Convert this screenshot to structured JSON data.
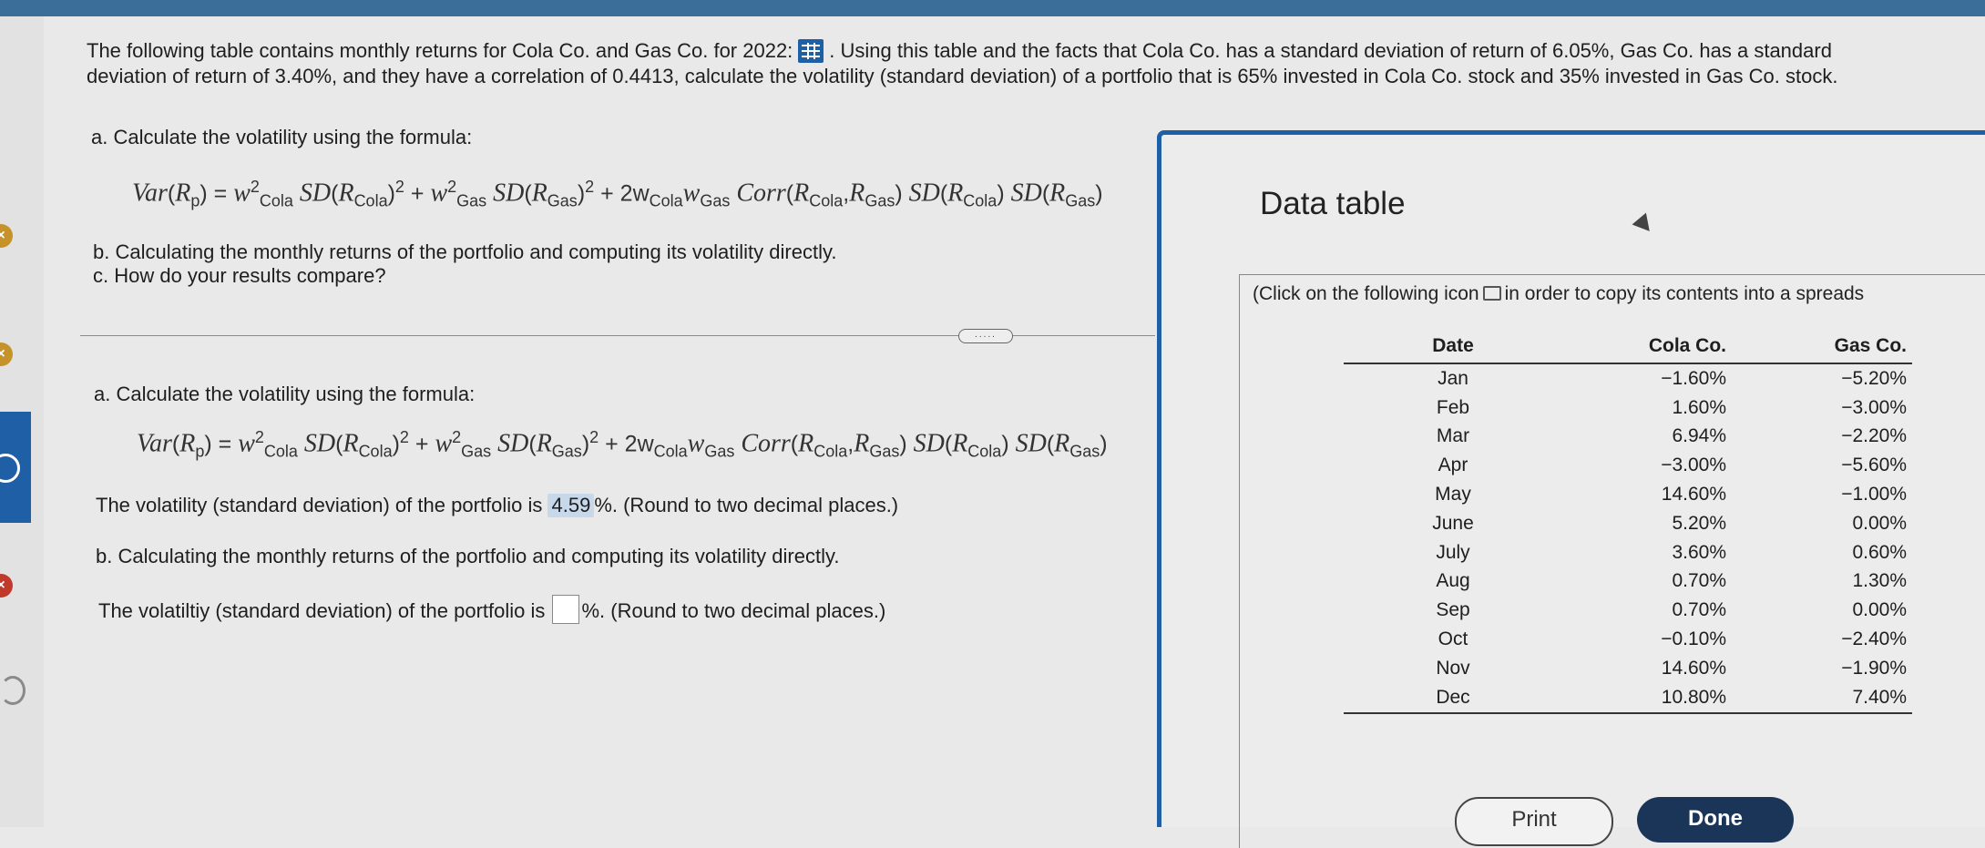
{
  "question": {
    "intro_before_icon": "The following table contains monthly returns for Cola Co. and Gas Co. for 2022:",
    "intro_after_icon": ". Using this table and the facts that Cola Co. has a standard deviation of return of 6.05%, Gas Co. has a standard deviation of return of 3.40%, and they have a correlation of 0.4413, calculate the volatility (standard deviation) of a portfolio that is 65% invested in Cola Co. stock and 35% invested in Gas Co. stock.",
    "part_a": "a. Calculate the volatility using the formula:",
    "part_b": "b. Calculating the monthly returns of the portfolio and computing its volatility directly.",
    "part_c": "c. How do your results compare?"
  },
  "formula": {
    "var": "Var",
    "rp": "R",
    "p": "p",
    "w": "w",
    "cola": "Cola",
    "gas": "Gas",
    "sd": "SD",
    "r": "R",
    "two": "2",
    "corr": "Corr",
    "eq": "=",
    "plus": "+",
    "two_w": "2w"
  },
  "answer": {
    "part_a_label": "a. Calculate the volatility using the formula:",
    "line_a_prefix": "The volatility (standard deviation) of the portfolio is",
    "line_a_value": "4.59",
    "line_a_suffix": "%. (Round to two decimal places.)",
    "part_b_label": "b. Calculating the monthly returns of the portfolio and computing its volatility directly.",
    "line_b_prefix": "The volatiltiy (standard deviation) of the portfolio is",
    "line_b_value": "",
    "line_b_suffix": "%. (Round to two decimal places.)",
    "more_label": "....."
  },
  "dialog": {
    "title": "Data table",
    "instruction_before": "(Click on the following icon",
    "instruction_after": "in order to copy its contents into a spreads",
    "headers": [
      "Date",
      "Cola Co.",
      "Gas Co."
    ],
    "rows": [
      [
        "Jan",
        "−1.60%",
        "−5.20%"
      ],
      [
        "Feb",
        "1.60%",
        "−3.00%"
      ],
      [
        "Mar",
        "6.94%",
        "−2.20%"
      ],
      [
        "Apr",
        "−3.00%",
        "−5.60%"
      ],
      [
        "May",
        "14.60%",
        "−1.00%"
      ],
      [
        "June",
        "5.20%",
        "0.00%"
      ],
      [
        "July",
        "3.60%",
        "0.60%"
      ],
      [
        "Aug",
        "0.70%",
        "1.30%"
      ],
      [
        "Sep",
        "0.70%",
        "0.00%"
      ],
      [
        "Oct",
        "−0.10%",
        "−2.40%"
      ],
      [
        "Nov",
        "14.60%",
        "−1.90%"
      ],
      [
        "Dec",
        "10.80%",
        "7.40%"
      ]
    ],
    "print_label": "Print",
    "done_label": "Done"
  },
  "sidebar": {
    "x_mark": "×"
  },
  "colors": {
    "accent": "#1f5fa6",
    "done": "#1b3558",
    "highlight": "#c7d8ea",
    "status": "#c6932a"
  }
}
